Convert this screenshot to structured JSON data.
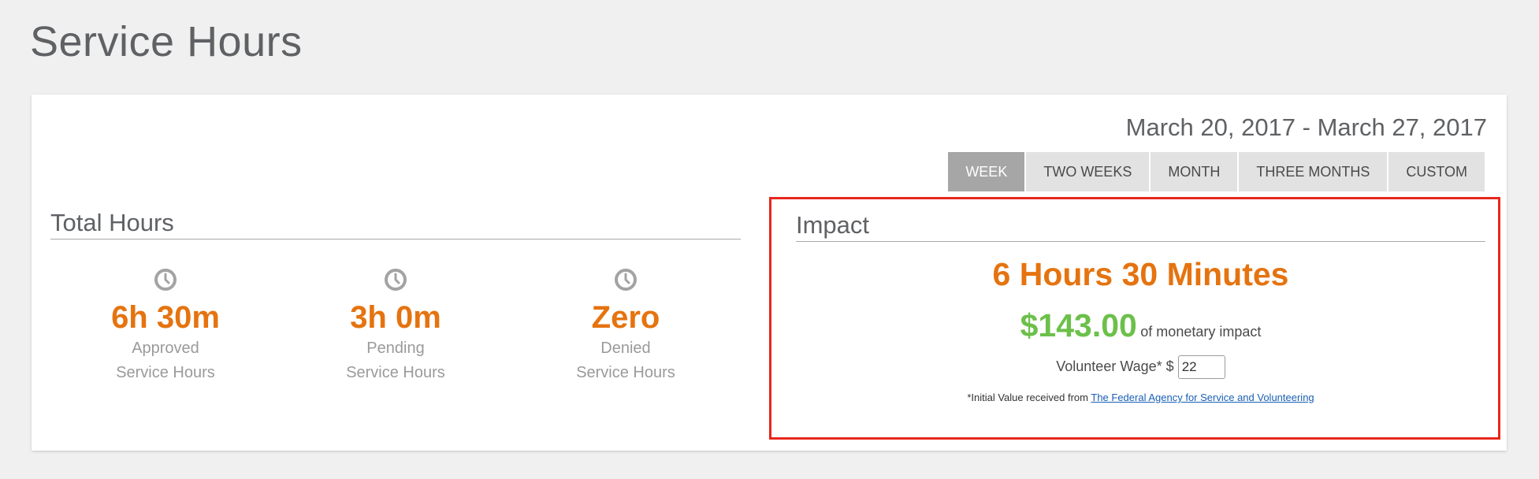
{
  "page": {
    "title": "Service Hours"
  },
  "date_range": "March 20, 2017 - March 27, 2017",
  "range_tabs": [
    {
      "label": "WEEK",
      "active": true
    },
    {
      "label": "TWO WEEKS",
      "active": false
    },
    {
      "label": "MONTH",
      "active": false
    },
    {
      "label": "THREE MONTHS",
      "active": false
    },
    {
      "label": "CUSTOM",
      "active": false
    }
  ],
  "total_hours": {
    "title": "Total Hours",
    "stats": [
      {
        "icon": "clock-icon",
        "value": "6h 30m",
        "label_line1": "Approved",
        "label_line2": "Service Hours"
      },
      {
        "icon": "clock-icon",
        "value": "3h 0m",
        "label_line1": "Pending",
        "label_line2": "Service Hours"
      },
      {
        "icon": "clock-icon",
        "value": "Zero",
        "label_line1": "Denied",
        "label_line2": "Service Hours"
      }
    ]
  },
  "impact": {
    "title": "Impact",
    "hours_text": "6 Hours 30 Minutes",
    "monetary_value": "$143.00",
    "monetary_label": "of monetary impact",
    "wage_label": "Volunteer Wage* $",
    "wage_value": "22",
    "footnote_prefix": "*Initial Value received from",
    "footnote_link": "The Federal Agency for Service and Volunteering"
  },
  "colors": {
    "accent_orange": "#e5730f",
    "money_green": "#6cc04a",
    "highlight_red": "#e8271c",
    "active_tab": "#a6a6a6"
  }
}
